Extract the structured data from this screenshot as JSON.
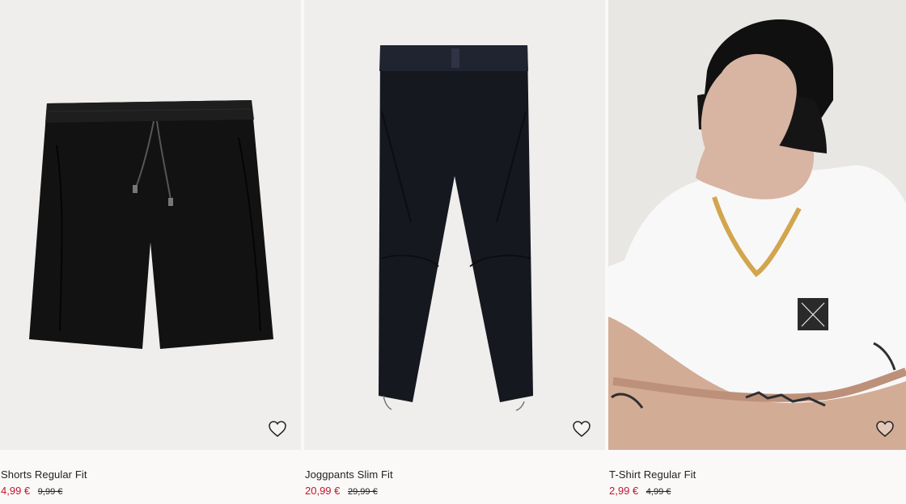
{
  "products": [
    {
      "title": "Shorts Regular Fit",
      "price_now": "4,99 €",
      "price_old": "9,99 €",
      "image_alt": "black shorts",
      "favorite_icon": "heart-icon"
    },
    {
      "title": "Joggpants Slim Fit",
      "price_now": "20,99 €",
      "price_old": "29,99 €",
      "image_alt": "black jogger pants",
      "favorite_icon": "heart-icon"
    },
    {
      "title": "T-Shirt Regular Fit",
      "price_now": "2,99 €",
      "price_old": "4,99 €",
      "image_alt": "model wearing white t-shirt and black bucket hat",
      "favorite_icon": "heart-icon"
    }
  ],
  "colors": {
    "sale_price": "#c4152a",
    "text": "#222222",
    "image_bg": "#efeeec",
    "page_bg": "#faf9f8"
  }
}
